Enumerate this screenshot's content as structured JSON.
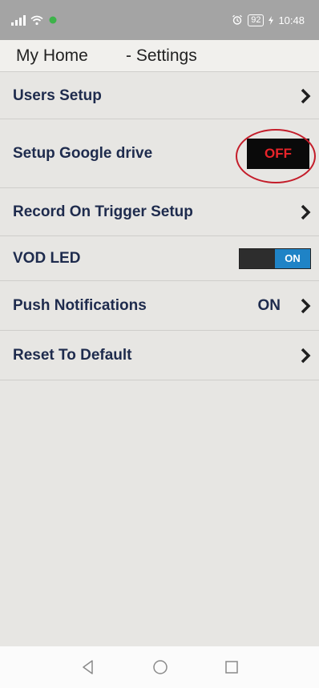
{
  "status_bar": {
    "battery": "92",
    "time": "10:48"
  },
  "header": {
    "app_name": "My Home",
    "section": "- Settings"
  },
  "settings": {
    "users_setup": {
      "label": "Users Setup"
    },
    "google_drive": {
      "label": "Setup Google drive",
      "toggle": "OFF"
    },
    "record_trigger": {
      "label": "Record On Trigger Setup"
    },
    "vod_led": {
      "label": "VOD LED",
      "toggle": "ON"
    },
    "push_notifications": {
      "label": "Push Notifications",
      "value": "ON"
    },
    "reset_default": {
      "label": "Reset To Default"
    }
  },
  "colors": {
    "accent_blue": "#1f83c6",
    "toggle_off_text": "#e8242a",
    "highlight_ring": "#c41d2a",
    "label_text": "#1e2b4d"
  },
  "icons": [
    "signal-icon",
    "wifi-icon",
    "alarm-icon",
    "battery-icon",
    "chevron-right-icon",
    "back-icon",
    "home-icon",
    "recents-icon"
  ]
}
